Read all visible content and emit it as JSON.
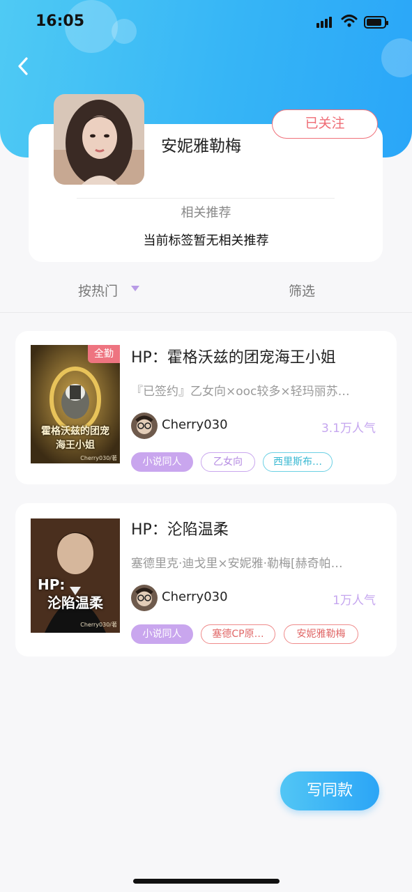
{
  "status_bar": {
    "time": "16:05"
  },
  "profile": {
    "name": "安妮雅勒梅",
    "follow_label": "已关注",
    "related_title": "相关推荐",
    "related_empty": "当前标签暂无相关推荐"
  },
  "filters": {
    "sort_label": "按热门",
    "filter_label": "筛选"
  },
  "books": [
    {
      "title": "HP：霍格沃兹的团宠海王小姐",
      "description": "『已签约』乙女向×ooc较多×轻玛丽苏…",
      "author": "Cherry030",
      "popularity": "3.1万人气",
      "badge": "全勤",
      "cover_text": [
        "霍格沃兹的团宠",
        "海王小姐"
      ],
      "cover_credit": "Cherry030/著",
      "tags": [
        {
          "label": "小说同人",
          "style": "fill"
        },
        {
          "label": "乙女向",
          "style": "purple"
        },
        {
          "label": "西里斯布…",
          "style": "cyan"
        }
      ]
    },
    {
      "title": "HP：沦陷温柔",
      "description": "塞德里克·迪戈里×安妮雅·勒梅[赫奇帕…",
      "author": "Cherry030",
      "popularity": "1万人气",
      "badge": "",
      "cover_text": [
        "HP:",
        "沦陷温柔"
      ],
      "cover_credit": "Cherry030/著",
      "tags": [
        {
          "label": "小说同人",
          "style": "fill"
        },
        {
          "label": "塞德CP原…",
          "style": "red"
        },
        {
          "label": "安妮雅勒梅",
          "style": "red"
        }
      ]
    }
  ],
  "write_button_label": "写同款",
  "colors": {
    "accent": "#36b5f6",
    "follow": "#ef6b74",
    "tag_purple": "#c9a6ee",
    "popularity": "#c5a6ef"
  }
}
